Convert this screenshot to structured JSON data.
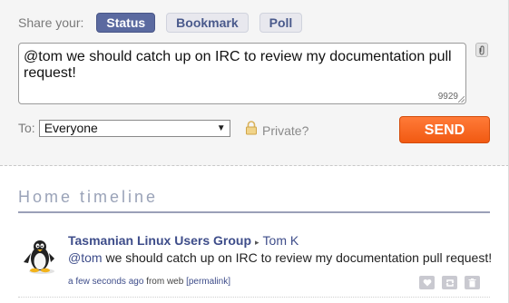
{
  "share": {
    "label": "Share your:",
    "tabs": [
      {
        "label": "Status",
        "active": true
      },
      {
        "label": "Bookmark",
        "active": false
      },
      {
        "label": "Poll",
        "active": false
      }
    ]
  },
  "status": {
    "text": "@tom we should catch up on IRC to review my documentation pull request!",
    "char_count": "9929"
  },
  "to": {
    "label": "To:",
    "selected": "Everyone"
  },
  "private": {
    "label": "Private?"
  },
  "send": {
    "label": "SEND"
  },
  "timeline": {
    "title": "Home timeline",
    "notices": [
      {
        "group": "Tasmanian Linux Users Group",
        "recipient": "Tom K",
        "mention": "@tom",
        "text": " we should catch up on IRC to review my documentation pull request!",
        "time": "a few seconds ago",
        "source": "from web",
        "permalink": "[permalink]"
      }
    ]
  },
  "colors": {
    "accent": "#5b6aa0",
    "send": "#f15a12",
    "link": "#3e4d8a"
  }
}
